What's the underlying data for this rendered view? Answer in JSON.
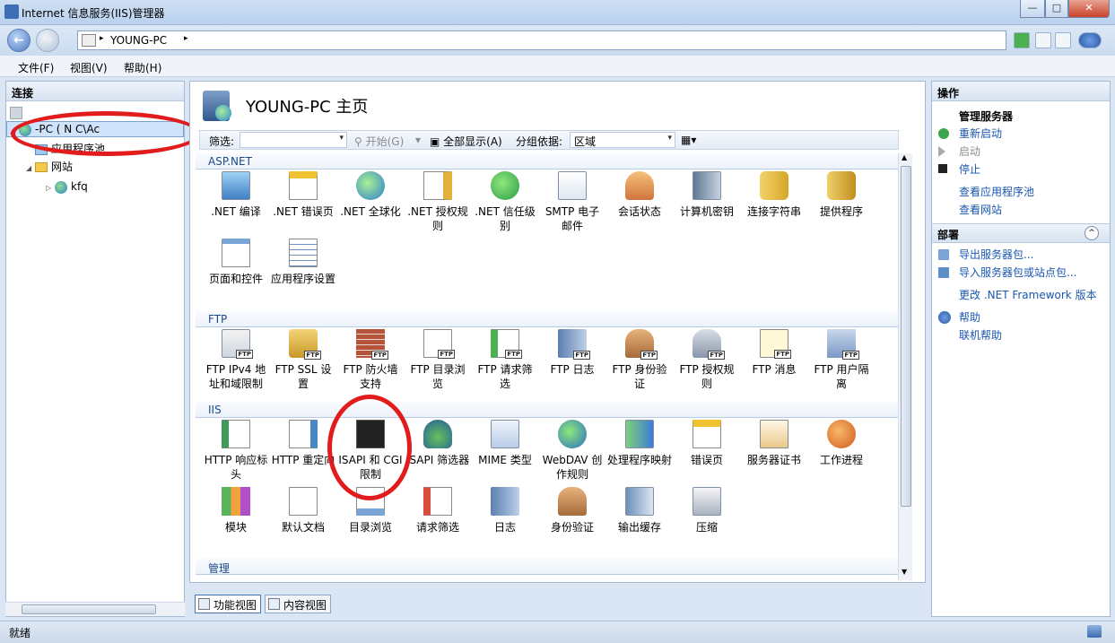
{
  "window": {
    "title": "Internet 信息服务(IIS)管理器",
    "min": "—",
    "max": "□",
    "close": "✕"
  },
  "address": {
    "path": "YOUNG-PC",
    "sep1": "▸",
    "sep2": "▸"
  },
  "menu": [
    "文件(F)",
    "视图(V)",
    "帮助(H)"
  ],
  "connections": {
    "title": "连接",
    "server": "-PC (  N  C\\Ac",
    "children": [
      "应用程序池",
      "网站"
    ],
    "site": "kfq"
  },
  "center": {
    "title": "YOUNG-PC 主页",
    "filter_label": "筛选:",
    "go_label": "开始(G)",
    "show_all_label": "全部显示(A)",
    "group_label": "分组依据:",
    "group_value": "区域",
    "sections": {
      "aspnet": {
        "label": "ASP.NET",
        "items": [
          ".NET 编译",
          ".NET 错误页",
          ".NET 全球化",
          ".NET 授权规则",
          ".NET 信任级别",
          "SMTP 电子邮件",
          "会话状态",
          "计算机密钥",
          "连接字符串",
          "提供程序",
          "页面和控件",
          "应用程序设置"
        ]
      },
      "ftp": {
        "label": "FTP",
        "items": [
          "FTP IPv4 地址和域限制",
          "FTP SSL 设置",
          "FTP 防火墙支持",
          "FTP 目录浏览",
          "FTP 请求筛选",
          "FTP 日志",
          "FTP 身份验证",
          "FTP 授权规则",
          "FTP 消息",
          "FTP 用户隔离"
        ]
      },
      "iis": {
        "label": "IIS",
        "items": [
          "HTTP 响应标头",
          "HTTP 重定向",
          "ISAPI 和 CGI 限制",
          "ISAPI 筛选器",
          "MIME 类型",
          "WebDAV 创作规则",
          "处理程序映射",
          "错误页",
          "服务器证书",
          "工作进程",
          "模块",
          "默认文档",
          "目录浏览",
          "请求筛选",
          "日志",
          "身份验证",
          "输出缓存",
          "压缩"
        ]
      },
      "manage": {
        "label": "管理"
      }
    },
    "tabs": [
      "功能视图",
      "内容视图"
    ]
  },
  "actions": {
    "title": "操作",
    "manage_server": "管理服务器",
    "restart": "重新启动",
    "start": "启动",
    "stop": "停止",
    "view_pools": "查看应用程序池",
    "view_sites": "查看网站",
    "deploy_title": "部署",
    "export": "导出服务器包...",
    "import": "导入服务器包或站点包...",
    "change_net": "更改 .NET Framework 版本",
    "help": "帮助",
    "online_help": "联机帮助"
  },
  "status": {
    "text": "就绪"
  },
  "colors": {
    "accent": "#1a56b0",
    "annotation": "#e21c1c"
  }
}
